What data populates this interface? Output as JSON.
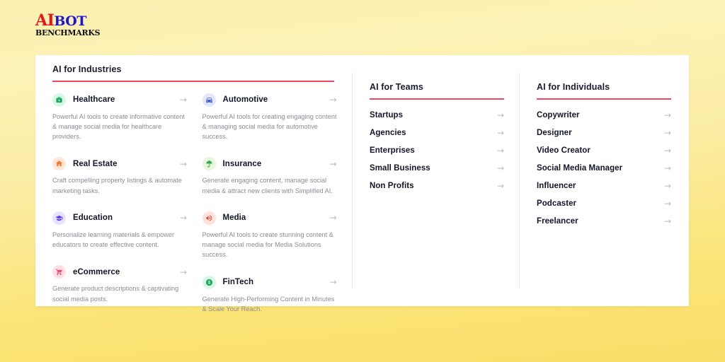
{
  "logo": {
    "part_ai": "AI",
    "part_bot": "BOT",
    "part_benchmarks": "BENCHMARKS",
    "color_ai": "#e8151d",
    "color_bot": "#1a18d8",
    "color_benchmarks": "#111111"
  },
  "theme": {
    "background": "#fbe478",
    "card_background": "#ffffff",
    "accent_rule": "#f2445c",
    "arrow_color": "#b9bac4",
    "heading_color": "#14142b",
    "description_color": "#8a8b99"
  },
  "arrow_glyph": "→",
  "industries": {
    "title": "AI for Industries",
    "columns": [
      {
        "items": [
          {
            "name": "Healthcare",
            "description": "Powerful AI tools to create informative content & manage social media for healthcare providers.",
            "icon": "medical-bag-icon",
            "icon_bg": "#d8f7e6",
            "icon_fg": "#17a760"
          },
          {
            "name": "Real Estate",
            "description": "Craft compelling property listings & automate marketing tasks.",
            "icon": "house-icon",
            "icon_bg": "#ffe6d6",
            "icon_fg": "#f4772e"
          },
          {
            "name": "Education",
            "description": "Personalize learning materials & empower educators to create effective content.",
            "icon": "graduation-cap-icon",
            "icon_bg": "#e8e1ff",
            "icon_fg": "#5b3cf0"
          },
          {
            "name": "eCommerce",
            "description": "Generate product descriptions & captivating social media posts.",
            "icon": "shopping-cart-icon",
            "icon_bg": "#ffe0e6",
            "icon_fg": "#ef4a6b"
          }
        ]
      },
      {
        "items": [
          {
            "name": "Automotive",
            "description": "Powerful AI tools for creating engaging content & managing social media for automotive success.",
            "icon": "car-icon",
            "icon_bg": "#e3e6ff",
            "icon_fg": "#3b5bdb"
          },
          {
            "name": "Insurance",
            "description": "Generate engaging content, manage social media & attract new clients with Simplified AI.",
            "icon": "umbrella-icon",
            "icon_bg": "#e6f8da",
            "icon_fg": "#38a95a"
          },
          {
            "name": "Media",
            "description": "Powerful AI tools to create stunning content & manage social media for Media Solutions success.",
            "icon": "megaphone-icon",
            "icon_bg": "#ffe2dc",
            "icon_fg": "#f0402f"
          },
          {
            "name": "FinTech",
            "description": "Generate High-Performing Content in Minutes & Scale Your Reach.",
            "icon": "coin-icon",
            "icon_bg": "#d9f7e3",
            "icon_fg": "#18a95e"
          }
        ]
      }
    ]
  },
  "teams": {
    "title": "AI for Teams",
    "items": [
      {
        "label": "Startups"
      },
      {
        "label": "Agencies"
      },
      {
        "label": "Enterprises"
      },
      {
        "label": "Small Business"
      },
      {
        "label": "Non Profits"
      }
    ]
  },
  "individuals": {
    "title": "AI for Individuals",
    "items": [
      {
        "label": "Copywriter"
      },
      {
        "label": "Designer"
      },
      {
        "label": "Video Creator"
      },
      {
        "label": "Social Media Manager"
      },
      {
        "label": "Influencer"
      },
      {
        "label": "Podcaster"
      },
      {
        "label": "Freelancer"
      }
    ]
  }
}
